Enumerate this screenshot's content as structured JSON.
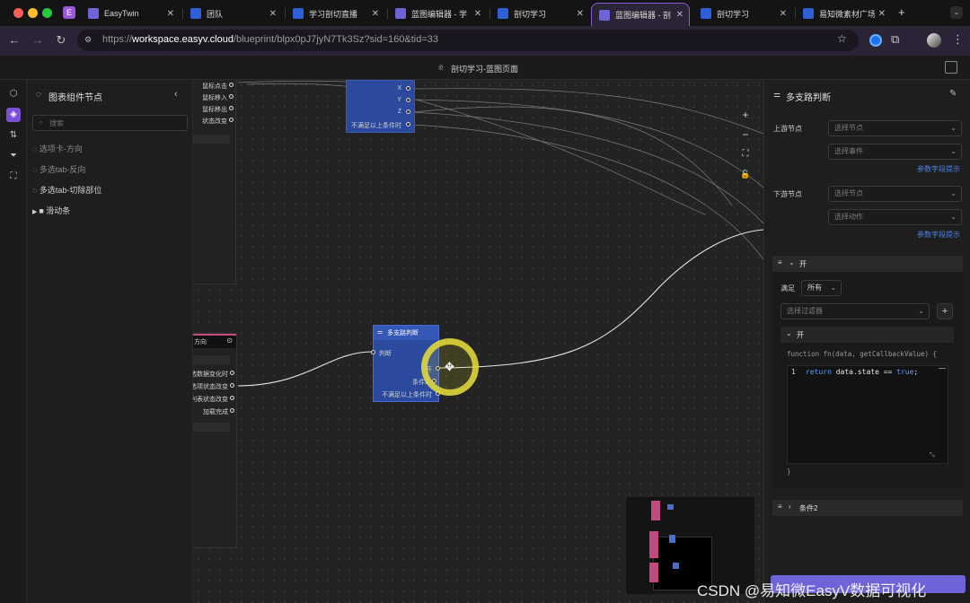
{
  "browser": {
    "tabs": [
      {
        "label": "EasyTwin",
        "favicon": "purple-cube-icon"
      },
      {
        "label": "团队",
        "favicon": "easyv-icon"
      },
      {
        "label": "学习剖切直播",
        "favicon": "easyv-icon"
      },
      {
        "label": "蓝图编辑器 - 学",
        "favicon": "purple-cube-icon"
      },
      {
        "label": "剖切学习",
        "favicon": "easyv-icon"
      },
      {
        "label": "蓝图编辑器 - 剖",
        "favicon": "purple-cube-icon",
        "active": true
      },
      {
        "label": "剖切学习",
        "favicon": "easyv-icon"
      },
      {
        "label": "易知微素材广场",
        "favicon": "easyv-icon"
      }
    ],
    "profile_letter": "E",
    "new_tab": "+",
    "url_prefix": "https://",
    "url_host": "workspace.easyv.cloud",
    "url_path": "/blueprint/blpx0pJ7jyN7Tk3Sz?sid=160&tid=33"
  },
  "app": {
    "title": "剖切学习-蓝图页面"
  },
  "sidebar": {
    "title": "图表组件节点",
    "search_placeholder": "搜索",
    "items": [
      {
        "label": "选项卡-方向",
        "dim": true
      },
      {
        "label": "多选tab-反向",
        "dim": true
      },
      {
        "label": "多选tab-切除部位",
        "dim": false
      }
    ],
    "folder": {
      "label": "滑动条"
    }
  },
  "canvas": {
    "top_left_ports": [
      "鼠标点击",
      "鼠标移入",
      "鼠标移出",
      "状态改变"
    ],
    "top_node_ports": [
      "X",
      "Y",
      "Z",
      "不满足以上条件时"
    ],
    "mid_left_node": {
      "title_fragment": "方向",
      "ports": [
        "选数据变化时",
        "选项状态改变",
        "列表状态改变",
        "加载完成"
      ]
    },
    "branch_node": {
      "title": "多支路判断",
      "input": "判断",
      "outputs": [
        "开",
        "条件2",
        "不满足以上条件时"
      ]
    },
    "zoom_controls": [
      "+",
      "−",
      "⛶",
      "🔓"
    ]
  },
  "panel": {
    "title": "多支路判断",
    "upstream_label": "上游节点",
    "upstream_node_placeholder": "选择节点",
    "upstream_event_placeholder": "选择事件",
    "param_link": "参数字段提示",
    "downstream_label": "下游节点",
    "downstream_node_placeholder": "选择节点",
    "downstream_action_placeholder": "选择动作",
    "branch1": {
      "name": "开",
      "satisfy_label": "满足",
      "satisfy_value": "所有",
      "filter_placeholder": "选择过滤器",
      "sub_name": "开",
      "fn_signature": "function fn(data, getCallbackValue) {",
      "line_no": "1",
      "code_keyword": "return",
      "code_mid": " data.state == ",
      "code_value": "true",
      "code_end": ";",
      "fn_close": "}"
    },
    "branch2": {
      "name": "条件2"
    }
  },
  "watermark": "CSDN @易知微EasyV数据可视化",
  "colors": {
    "accent": "#8e5ad8",
    "node_blue": "#2b4a9e",
    "link_blue": "#4e84e8",
    "code_blue": "#5c9cff",
    "minimap_pink": "#c24a7e"
  }
}
